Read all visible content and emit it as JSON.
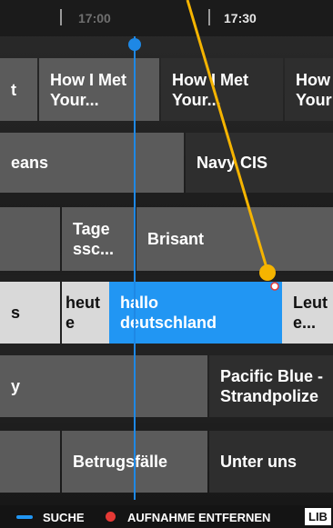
{
  "timeline": {
    "times": [
      "17:00",
      "17:30"
    ]
  },
  "rows": [
    [
      {
        "title": "t",
        "style": "gray"
      },
      {
        "title": "How I Met\nYour...",
        "style": "gray"
      },
      {
        "title": "How I Met\nYour...",
        "style": "dark"
      },
      {
        "title": "How\nYour",
        "style": "dark"
      }
    ],
    [
      {
        "title": "eans",
        "style": "gray"
      },
      {
        "title": "Navy CIS",
        "style": "dark"
      }
    ],
    [
      {
        "title": "",
        "style": "gray"
      },
      {
        "title": "Tage\nssc...",
        "style": "gray"
      },
      {
        "title": "Brisant",
        "style": "gray"
      }
    ],
    [
      {
        "title": "s",
        "style": "light"
      },
      {
        "title": "heut\ne",
        "style": "light"
      },
      {
        "title": "hallo\ndeutschland",
        "style": "blue"
      },
      {
        "title": "Leut\ne...",
        "style": "light"
      }
    ],
    [
      {
        "title": "y",
        "style": "gray"
      },
      {
        "title": "Pacific Blue -\nStrandpolize",
        "style": "dark"
      }
    ],
    [
      {
        "title": "",
        "style": "gray"
      },
      {
        "title": "Betrugsfälle",
        "style": "gray"
      },
      {
        "title": "Unter uns",
        "style": "dark"
      }
    ]
  ],
  "footer": {
    "search_label": "SUCHE",
    "remove_recording_label": "AUFNAHME ENTFERNEN",
    "lib_label": "LIB",
    "colors": {
      "blue": "#2196f3",
      "red": "#e53935"
    }
  }
}
